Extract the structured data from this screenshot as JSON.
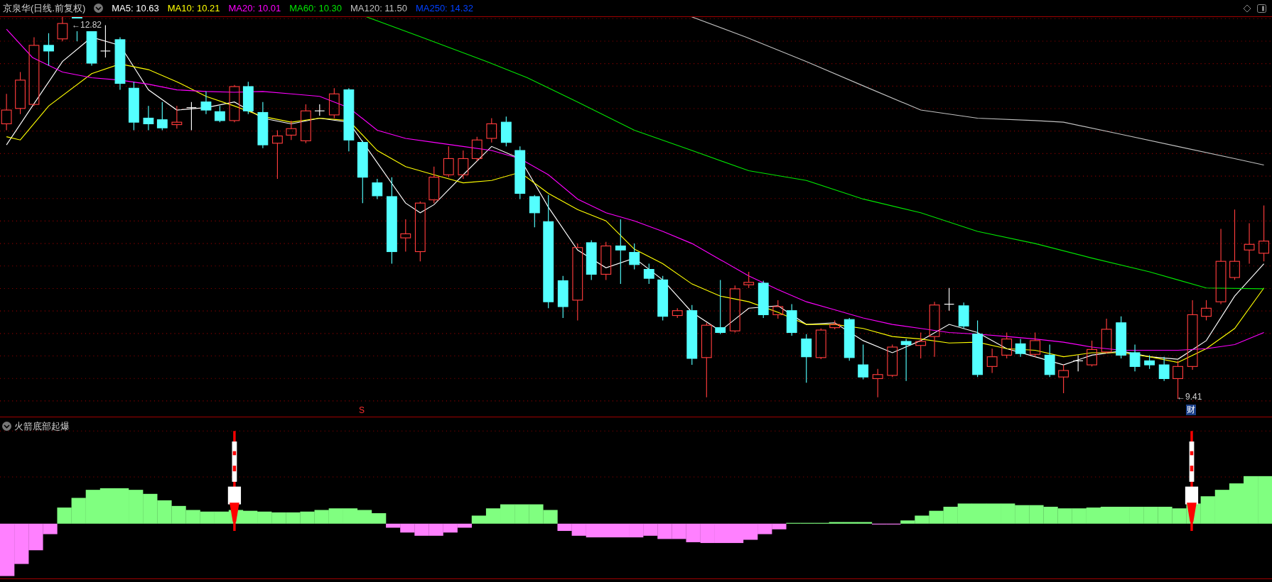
{
  "header": {
    "title": "京泉华(日线.前复权)",
    "indicators": [
      {
        "label": "MA5: 10.63",
        "color": "#ffffff"
      },
      {
        "label": "MA10: 10.21",
        "color": "#ffff00"
      },
      {
        "label": "MA20: 10.01",
        "color": "#ff00ff"
      },
      {
        "label": "MA60: 10.30",
        "color": "#00e600"
      },
      {
        "label": "MA120: 11.50",
        "color": "#c0c0c0"
      },
      {
        "label": "MA250: 14.32",
        "color": "#0040ff"
      }
    ]
  },
  "price_chart": {
    "high_label": "←12.82",
    "low_label": "←9.41",
    "signal": "S",
    "badge": "财"
  },
  "indicator_panel": {
    "title": "火箭底部起爆"
  }
}
